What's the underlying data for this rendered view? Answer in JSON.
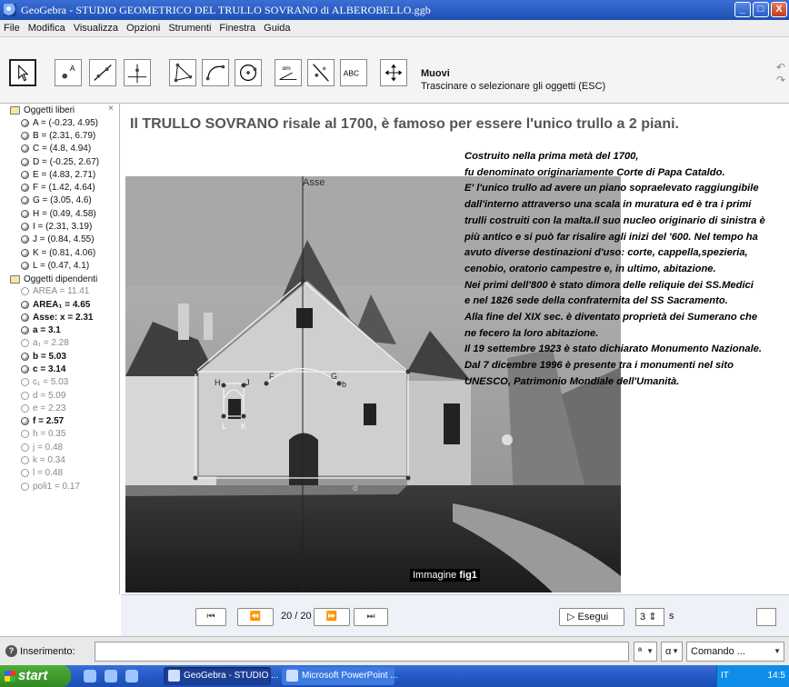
{
  "window": {
    "title": "GeoGebra - STUDIO GEOMETRICO DEL TRULLO SOVRANO di ALBEROBELLO.ggb",
    "buttons": [
      "_",
      "□",
      "X"
    ]
  },
  "menu": [
    "File",
    "Modifica",
    "Visualizza",
    "Opzioni",
    "Strumenti",
    "Finestra",
    "Guida"
  ],
  "toolbar": {
    "tools": [
      "move-tool",
      "point-tool",
      "line-tool",
      "perpendicular-tool",
      "polygon-tool",
      "circle-arc-tool",
      "conic-tool",
      "angle-tool",
      "reflect-tool",
      "text-tool",
      "translate-view-tool"
    ],
    "text_tool_label": "ABC",
    "angle_tool_label": "αm",
    "active_tool_name": "Muovi",
    "active_tool_help": "Trascinare o selezionare gli oggetti (ESC)"
  },
  "algebra": {
    "free_header": "Oggetti liberi",
    "free_objects": [
      "A = (-0.23, 4.95)",
      "B = (2.31, 6.79)",
      "C = (4.8, 4.94)",
      "D = (-0.25, 2.67)",
      "E = (4.83, 2.71)",
      "F = (1.42, 4.64)",
      "G = (3.05, 4.6)",
      "H = (0.49, 4.58)",
      "I = (2.31, 3.19)",
      "J = (0.84, 4.55)",
      "K = (0.81, 4.06)",
      "L = (0.47, 4.1)"
    ],
    "dependent_header": "Oggetti dipendenti",
    "dependent_objects": [
      {
        "text": "AREA = 11.41",
        "style": "hidden"
      },
      {
        "text": "AREA₁ = 4.65",
        "style": "bold"
      },
      {
        "text": "Asse: x = 2.31",
        "style": "bold"
      },
      {
        "text": "a = 3.1",
        "style": "bold"
      },
      {
        "text": "a₁ = 2.28",
        "style": "hidden"
      },
      {
        "text": "b = 5.03",
        "style": "bold"
      },
      {
        "text": "c = 3.14",
        "style": "bold"
      },
      {
        "text": "c₁ = 5.03",
        "style": "hidden"
      },
      {
        "text": "d = 5.09",
        "style": "hidden"
      },
      {
        "text": "e = 2.23",
        "style": "hidden"
      },
      {
        "text": "f = 2.57",
        "style": "bold"
      },
      {
        "text": "h = 0.35",
        "style": "hidden"
      },
      {
        "text": "j = 0.48",
        "style": "hidden"
      },
      {
        "text": "k = 0.34",
        "style": "hidden"
      },
      {
        "text": "l = 0.48",
        "style": "hidden"
      },
      {
        "text": "poli1 = 0.17",
        "style": "hidden"
      }
    ]
  },
  "graphics": {
    "headline": "Il TRULLO SOVRANO risale al 1700, è famoso per essere l'unico trullo a 2 piani.",
    "axis_label": "Asse",
    "image_label_prefix": "Immagine ",
    "image_label_name": "fig1",
    "point_labels": [
      "H",
      "J",
      "F",
      "G",
      "b",
      "L",
      "K",
      "d"
    ],
    "text_lines": [
      "Costruito nella prima metà del 1700,",
      "fu denominato originariamente Corte di Papa Cataldo.",
      "E' l'unico trullo ad avere un piano sopraelevato raggiungibile",
      "dall'interno attraverso una scala in muratura ed è tra i primi",
      "trulli costruiti con la malta.Il suo nucleo originario di sinistra è",
      "più antico e si può far risalire agli inizi del '600. Nel tempo ha",
      "avuto diverse destinazioni d'uso: corte, cappella,spezieria,",
      "cenobio, oratorio campestre e, in ultimo, abitazione.",
      "Nei primi dell'800 è stato dimora delle reliquie dei SS.Medici",
      "e nel 1826 sede della confraternita del SS Sacramento.",
      "Alla fine del XIX sec. è diventato proprietà dei Sumerano che",
      "ne fecero la loro abitazione.",
      "Il 19 settembre 1923 è stato dichiarato Monumento Nazionale.",
      "Dal 7 dicembre 1996 è presente tra i monumenti nel sito",
      "UNESCO, Patrimonio Mondiale dell'Umanità."
    ]
  },
  "playback": {
    "first": "⏮",
    "prev": "⏪",
    "step": "20 / 20",
    "next": "⏩",
    "last": "⏭",
    "run_label": "▷ Esegui",
    "speed_value": "3",
    "speed_unit": "s"
  },
  "input": {
    "label": "Inserimento:",
    "value": "",
    "symbol_select": "ª",
    "greek_select": "α",
    "command_select": "Comando ..."
  },
  "taskbar": {
    "start": "start",
    "tasks": [
      "GeoGebra - STUDIO ...",
      "Microsoft PowerPoint ..."
    ],
    "lang": "IT",
    "clock": "14:5"
  },
  "colors": {
    "titlebar": "#1f4fb3",
    "taskbar": "#245ac5",
    "start_button": "#2f8a22",
    "tray": "#0f8ee9"
  }
}
